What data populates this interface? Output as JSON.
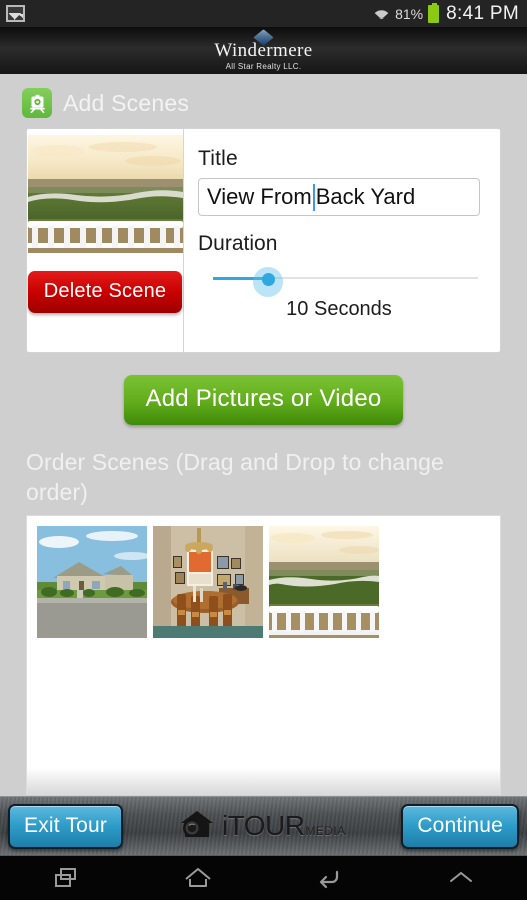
{
  "status_bar": {
    "notification_icon": "gallery-icon",
    "wifi_icon": "wifi-icon",
    "battery_percent": "81%",
    "battery_icon": "battery-icon",
    "time": "8:41 PM"
  },
  "brand": {
    "logo_icon": "windermere-diamond-icon",
    "name": "Windermere",
    "subtitle": "All Star Realty LLC."
  },
  "page": {
    "icon": "add-scenes-icon",
    "title": "Add Scenes"
  },
  "scene_card": {
    "thumbnail_alt": "scene-preview-back-yard",
    "title_label": "Title",
    "title_value_before_caret": "View From",
    "title_value_after_caret": "Back Yard",
    "title_value_full": "View From Back Yard",
    "title_placeholder": "Scene title",
    "duration_label": "Duration",
    "duration_value": "10 Seconds",
    "duration_seconds": 10,
    "slider_percent": 23,
    "delete_label": "Delete Scene"
  },
  "add_media": {
    "label": "Add Pictures or Video"
  },
  "order_section": {
    "heading": "Order Scenes (Drag and Drop to change order)",
    "thumbnails": [
      {
        "name": "scene-thumb-house-exterior"
      },
      {
        "name": "scene-thumb-dining-room"
      },
      {
        "name": "scene-thumb-back-yard-view"
      }
    ]
  },
  "footer": {
    "exit_label": "Exit Tour",
    "logo_icon": "itour-house-camera-icon",
    "logo_primary": "iTOUR",
    "logo_secondary": "MEDIA",
    "continue_label": "Continue"
  },
  "nav_bar": {
    "recents_icon": "recents-icon",
    "home_icon": "home-icon",
    "back_icon": "back-icon",
    "expand_icon": "chevron-up-icon"
  },
  "colors": {
    "background": "#cfcfcf",
    "accent_green": "#63ae1d",
    "accent_red": "#c70000",
    "accent_blue": "#2e9cc9",
    "slider_blue": "#2fa8e0",
    "battery_green": "#8bc913"
  }
}
